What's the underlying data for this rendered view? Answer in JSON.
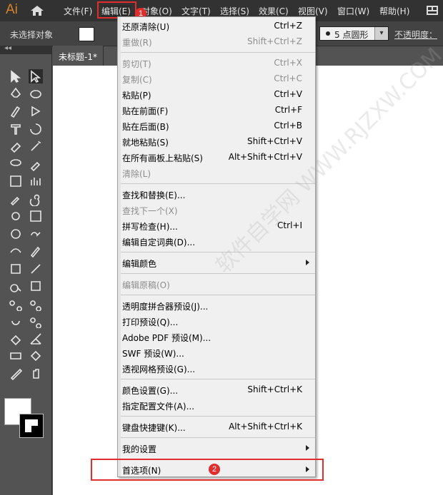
{
  "app": {
    "logo": "Ai"
  },
  "menubar": {
    "items": [
      "文件(F)",
      "编辑(E)",
      "对象(O)",
      "文字(T)",
      "选择(S)",
      "效果(C)",
      "视图(V)",
      "窗口(W)",
      "帮助(H)"
    ],
    "active": "编辑(E)"
  },
  "control_bar": {
    "selection_status": "未选择对象",
    "stroke_profile": "5 点圆形",
    "opacity_label": "不透明度："
  },
  "document_tab": {
    "title": "未标题-1*"
  },
  "annotations": {
    "badge1": "1",
    "badge2": "2",
    "highlight_color": "#e02d2d"
  },
  "edit_menu": {
    "items": [
      {
        "label": "还原清除(U)",
        "shortcut": "Ctrl+Z",
        "enabled": true
      },
      {
        "label": "重做(R)",
        "shortcut": "Shift+Ctrl+Z",
        "enabled": false
      },
      {
        "separator": true
      },
      {
        "label": "剪切(T)",
        "shortcut": "Ctrl+X",
        "enabled": false
      },
      {
        "label": "复制(C)",
        "shortcut": "Ctrl+C",
        "enabled": false
      },
      {
        "label": "粘贴(P)",
        "shortcut": "Ctrl+V",
        "enabled": true
      },
      {
        "label": "贴在前面(F)",
        "shortcut": "Ctrl+F",
        "enabled": true
      },
      {
        "label": "贴在后面(B)",
        "shortcut": "Ctrl+B",
        "enabled": true
      },
      {
        "label": "就地粘贴(S)",
        "shortcut": "Shift+Ctrl+V",
        "enabled": true
      },
      {
        "label": "在所有画板上粘贴(S)",
        "shortcut": "Alt+Shift+Ctrl+V",
        "enabled": true
      },
      {
        "label": "清除(L)",
        "shortcut": "",
        "enabled": false
      },
      {
        "separator": true
      },
      {
        "label": "查找和替换(E)...",
        "shortcut": "",
        "enabled": true
      },
      {
        "label": "查找下一个(X)",
        "shortcut": "",
        "enabled": false
      },
      {
        "label": "拼写检查(H)...",
        "shortcut": "Ctrl+I",
        "enabled": true
      },
      {
        "label": "编辑自定词典(D)...",
        "shortcut": "",
        "enabled": true
      },
      {
        "separator": true
      },
      {
        "label": "编辑颜色",
        "shortcut": "",
        "enabled": true,
        "submenu": true
      },
      {
        "separator": true
      },
      {
        "label": "编辑原稿(O)",
        "shortcut": "",
        "enabled": false
      },
      {
        "separator": true
      },
      {
        "label": "透明度拼合器预设(J)...",
        "shortcut": "",
        "enabled": true
      },
      {
        "label": "打印预设(Q)...",
        "shortcut": "",
        "enabled": true
      },
      {
        "label": "Adobe PDF 预设(M)...",
        "shortcut": "",
        "enabled": true
      },
      {
        "label": "SWF 预设(W)...",
        "shortcut": "",
        "enabled": true
      },
      {
        "label": "透视网格预设(G)...",
        "shortcut": "",
        "enabled": true
      },
      {
        "separator": true
      },
      {
        "label": "颜色设置(G)...",
        "shortcut": "Shift+Ctrl+K",
        "enabled": true
      },
      {
        "label": "指定配置文件(A)...",
        "shortcut": "",
        "enabled": true
      },
      {
        "separator": true
      },
      {
        "label": "键盘快捷键(K)...",
        "shortcut": "Alt+Shift+Ctrl+K",
        "enabled": true
      },
      {
        "separator": true
      },
      {
        "label": "我的设置",
        "shortcut": "",
        "enabled": true,
        "submenu": true
      },
      {
        "separator": true
      },
      {
        "label": "首选项(N)",
        "shortcut": "",
        "enabled": true,
        "submenu": true
      }
    ]
  },
  "watermark": "软件自学网 WWW.RJZXW.COM"
}
